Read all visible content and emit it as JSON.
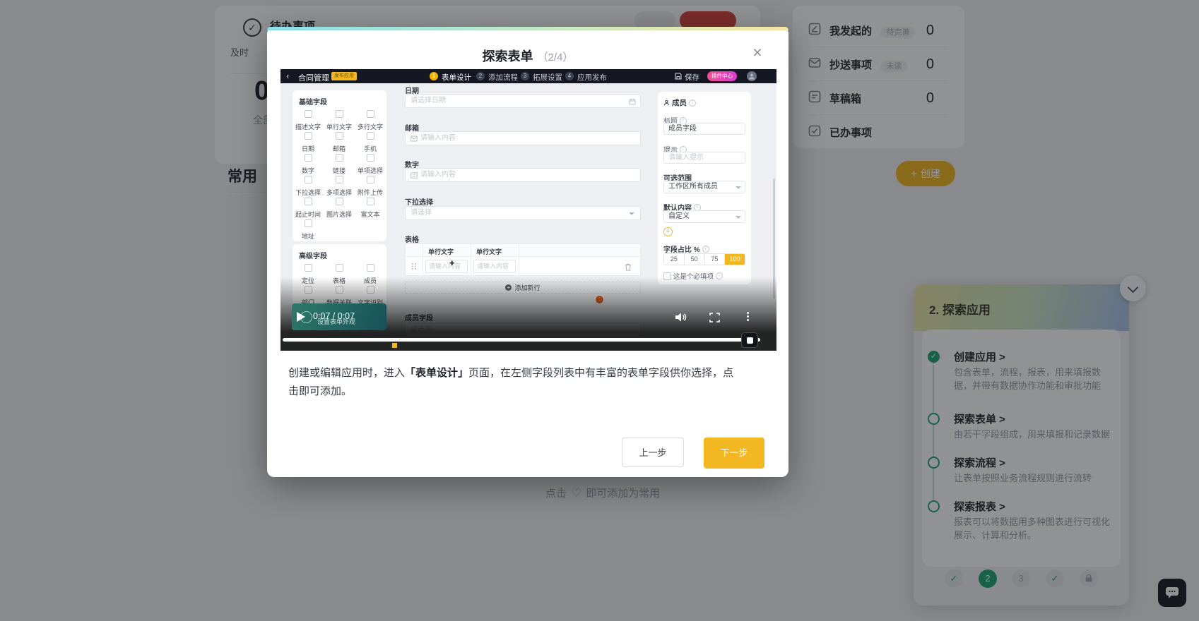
{
  "colors": {
    "accent_yellow": "#f3b722",
    "accent_pink_gradient": [
      "#ef4f8e",
      "#dc3bd3"
    ],
    "accent_green": "#21a675",
    "video_teal": "#2c7264",
    "red_button": "#d8453e"
  },
  "background": {
    "todo_card": {
      "title": "待办事项",
      "subtitle": "及时",
      "count": "0",
      "count_label": "全部"
    },
    "section_title": "常用",
    "create_button": "创建",
    "right_list": {
      "items": [
        {
          "label": "我发起的",
          "badge": "待完善",
          "count": "0"
        },
        {
          "label": "抄送事项",
          "badge": "未读",
          "count": "0"
        },
        {
          "label": "草稿箱",
          "badge": "",
          "count": "0"
        },
        {
          "label": "已办事项",
          "badge": "",
          "count": ""
        }
      ]
    },
    "favorite_hint": {
      "prefix": "点击",
      "heart": "♡",
      "suffix": "即可添加为常用"
    },
    "guide_panel": {
      "title": "2. 探索应用",
      "items": [
        {
          "title": "创建应用 >",
          "desc": "包含表单，流程，报表，用来填报数据，并带有数据协作功能和审批功能"
        },
        {
          "title": "探索表单 >",
          "desc": "由若干字段组成，用来填报和记录数据"
        },
        {
          "title": "探索流程 >",
          "desc": "让表单按照业务流程规则进行流转"
        },
        {
          "title": "探索报表 >",
          "desc": "报表可以将数据用多种图表进行可视化展示、计算和分析。"
        }
      ],
      "steps": {
        "two": "2",
        "three": "3"
      }
    }
  },
  "modal": {
    "title": "探索表单",
    "progress": "（2/4）",
    "description": {
      "part1": "创建或编辑应用时，进入",
      "bold": "「表单设计」",
      "part2": "页面，在左侧字段列表中有丰富的表单字段供你选择，点击即可添加。"
    },
    "prev_button": "上一步",
    "next_button": "下一步",
    "video": {
      "time": "0:07 / 0:07",
      "end_card": "设置表单外观",
      "app": {
        "name": "合同管理",
        "badge": "发布应用",
        "steps": [
          {
            "num": "1",
            "label": "表单设计"
          },
          {
            "num": "2",
            "label": "添加流程"
          },
          {
            "num": "3",
            "label": "拓展设置"
          },
          {
            "num": "4",
            "label": "应用发布"
          }
        ],
        "save": "保存",
        "plugin_center": "插件中心",
        "panel": {
          "basic_title": "基础字段",
          "basic_fields": [
            "描述文字",
            "单行文字",
            "多行文字",
            "日期",
            "邮箱",
            "手机",
            "数字",
            "链接",
            "单项选择",
            "下拉选择",
            "多项选择",
            "附件上传",
            "起止时间",
            "图片选择",
            "富文本",
            "地址"
          ],
          "advanced_title": "高级字段",
          "advanced_fields": [
            "定位",
            "表格",
            "成员",
            "部门",
            "数据关联",
            "文字识别"
          ]
        },
        "form": {
          "date_label": "日期",
          "date_placeholder": "请选择日期",
          "email_label": "邮箱",
          "email_placeholder": "请输入内容",
          "number_label": "数字",
          "number_placeholder": "请输入内容",
          "select_label": "下拉选择",
          "select_placeholder": "请选择",
          "table_label": "表格",
          "table_col1": "单行文字",
          "table_col2": "单行文字",
          "cell1_placeholder": "请输入内容",
          "cell2_placeholder": "请输入内容",
          "add_row": "添加新行",
          "member_label": "成员字段",
          "member_placeholder": "请选择"
        },
        "config": {
          "type": "成员",
          "title_label": "标题",
          "title_value": "成员字段",
          "hint_label": "提示",
          "hint_placeholder": "请输入提示",
          "range_label": "可选范围",
          "range_value": "工作区所有成员",
          "default_label": "默认内容",
          "default_value": "自定义",
          "ratio_label": "字段占比 %",
          "ratio_options": [
            "25",
            "50",
            "75",
            "100"
          ],
          "required_label": "这是个必填项"
        }
      }
    }
  }
}
